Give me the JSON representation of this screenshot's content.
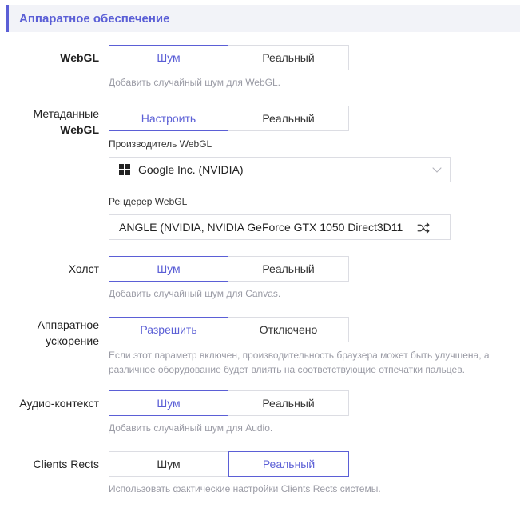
{
  "section": {
    "title": "Аппаратное обеспечение"
  },
  "webgl": {
    "label": "WebGL",
    "options": [
      "Шум",
      "Реальный"
    ],
    "selected": 0,
    "hint": "Добавить случайный шум для WebGL."
  },
  "webgl_meta": {
    "label_line1": "Метаданные",
    "label_line2": "WebGL",
    "options": [
      "Настроить",
      "Реальный"
    ],
    "selected": 0,
    "vendor_label": "Производитель WebGL",
    "vendor_value": "Google Inc. (NVIDIA)",
    "vendor_icon": "windows-icon",
    "renderer_label": "Рендерер WebGL",
    "renderer_value": "ANGLE (NVIDIA, NVIDIA GeForce GTX 1050 Direct3D11",
    "renderer_icon": "shuffle-icon"
  },
  "canvas": {
    "label": "Холст",
    "options": [
      "Шум",
      "Реальный"
    ],
    "selected": 0,
    "hint": "Добавить случайный шум для Canvas."
  },
  "hw_accel": {
    "label_line1": "Аппаратное",
    "label_line2": "ускорение",
    "options": [
      "Разрешить",
      "Отключено"
    ],
    "selected": 0,
    "hint_line1": "Если этот параметр включен, производительность браузера может быть улучшена, а",
    "hint_line2": "различное оборудование будет влиять на соответствующие отпечатки пальцев."
  },
  "audio": {
    "label": "Аудио-контекст",
    "options": [
      "Шум",
      "Реальный"
    ],
    "selected": 0,
    "hint": "Добавить случайный шум для Audio."
  },
  "client_rects": {
    "label": "Clients Rects",
    "options": [
      "Шум",
      "Реальный"
    ],
    "selected": 1,
    "hint": "Использовать фактические настройки Clients Rects системы."
  },
  "colors": {
    "accent": "#5b5fd6",
    "border": "#dcdde3",
    "hint": "#9a9ba5",
    "header_bg": "#f2f3f8"
  }
}
